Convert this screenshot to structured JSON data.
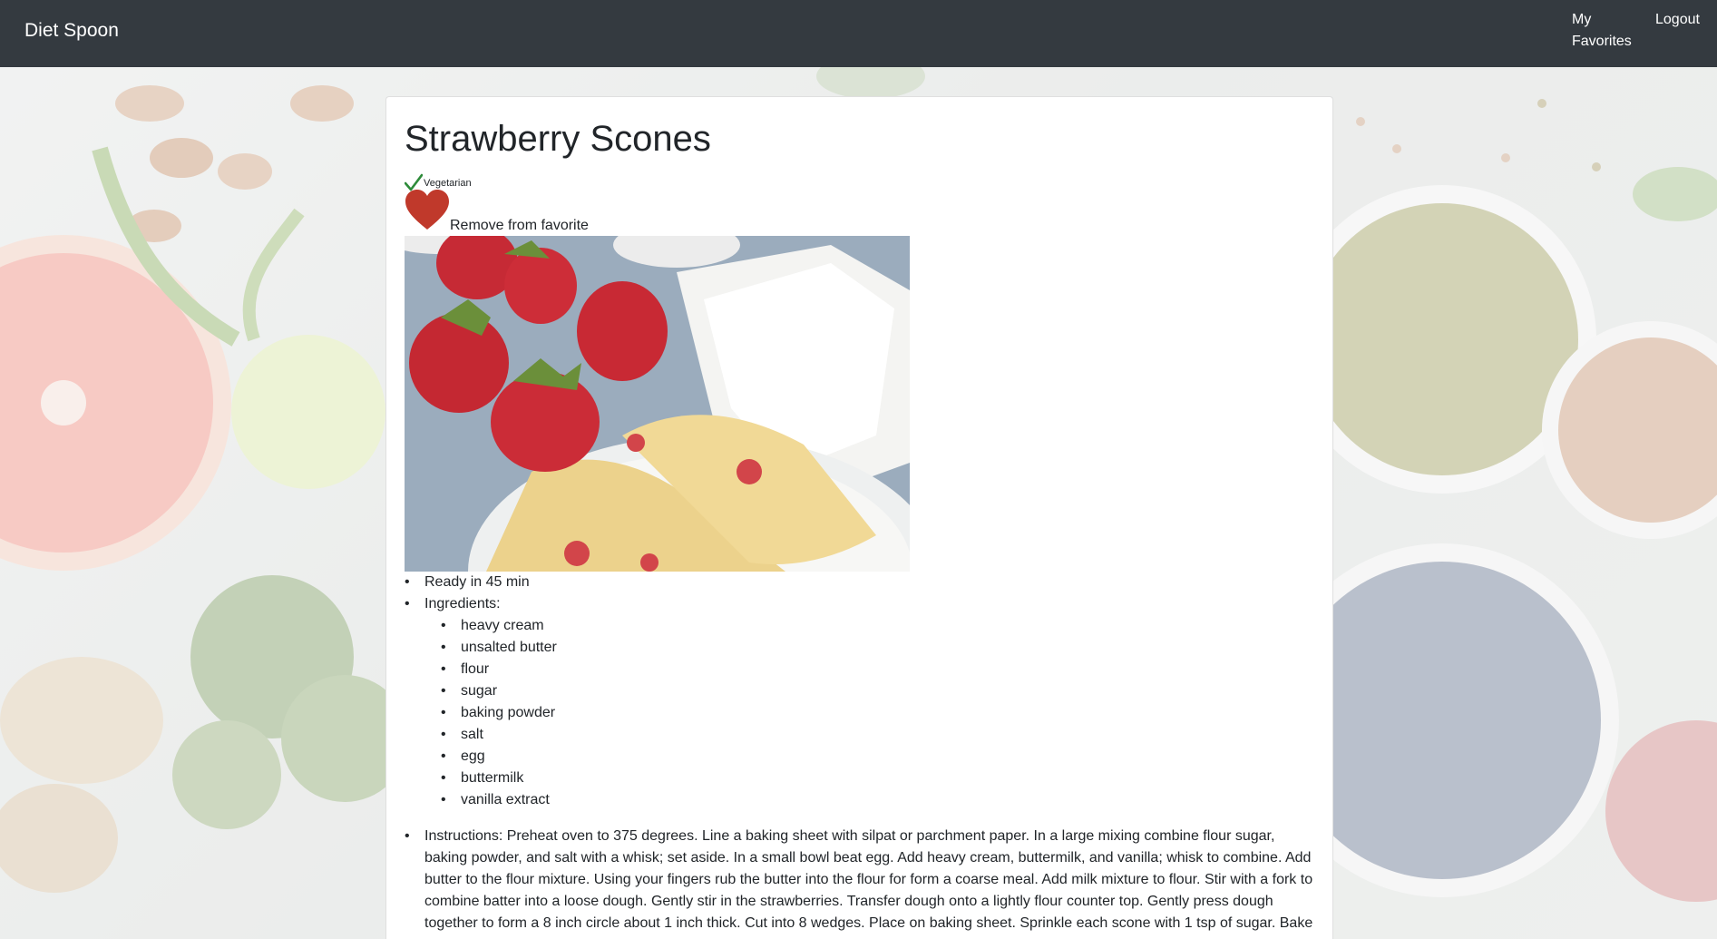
{
  "navbar": {
    "brand": "Diet Spoon",
    "links": {
      "favorites": "My Favorites",
      "logout": "Logout"
    }
  },
  "recipe": {
    "title": "Strawberry Scones",
    "diet_tag": "Vegetarian",
    "favorite_action": "Remove from favorite",
    "ready_text": "Ready in 45 min",
    "ingredients_label": "Ingredients:",
    "ingredients": [
      "heavy cream",
      "unsalted butter",
      "flour",
      "sugar",
      "baking powder",
      "salt",
      "egg",
      "buttermilk",
      "vanilla extract"
    ],
    "instructions": "Instructions: Preheat oven to 375 degrees. Line a baking sheet with silpat or parchment paper. In a large mixing combine flour sugar, baking powder, and salt with a whisk; set aside. In a small bowl beat egg. Add heavy cream, buttermilk, and vanilla; whisk to combine. Add butter to the flour mixture. Using your fingers rub the butter into the flour for form a coarse meal. Add milk mixture to flour. Stir with a fork to combine batter into a loose dough. Gently stir in the strawberries. Transfer dough onto a lightly flour counter top. Gently press dough together to form a 8 inch circle about 1 inch thick. Cut into 8 wedges. Place on baking sheet. Sprinkle each scone with 1 tsp of sugar. Bake"
  },
  "icons": {
    "check": "check-icon",
    "favorite": "heart-icon"
  },
  "colors": {
    "navbar": "#343a40",
    "check": "#2e8b3a",
    "heart": "#c0392b",
    "text": "#212529"
  }
}
